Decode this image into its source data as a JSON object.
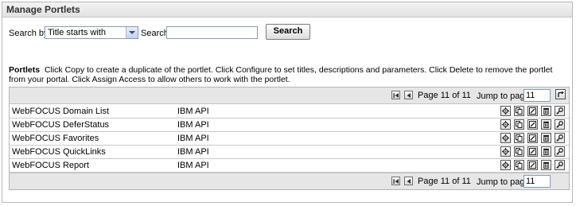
{
  "panel": {
    "title": "Manage Portlets"
  },
  "search": {
    "by_label": "Search by:",
    "by_value": "Title starts with",
    "label": "Search:",
    "value": "",
    "button_label": "Search"
  },
  "description": {
    "heading": "Portlets",
    "text": "Click Copy to create a duplicate of the portlet. Click Configure to set titles, descriptions and parameters. Click Delete to remove the portlet from your portal. Click Assign Access to allow others to work with the portlet."
  },
  "pager": {
    "info": "Page 11 of 11",
    "jump_label": "Jump to page:",
    "jump_value": "11"
  },
  "portlets": [
    {
      "name": "WebFOCUS Domain List",
      "type": "IBM API"
    },
    {
      "name": "WebFOCUS DeferStatus",
      "type": "IBM API"
    },
    {
      "name": "WebFOCUS Favorites",
      "type": "IBM API"
    },
    {
      "name": "WebFOCUS QuickLinks",
      "type": "IBM API"
    },
    {
      "name": "WebFOCUS Report",
      "type": "IBM API"
    }
  ],
  "row_actions": [
    "gear-icon",
    "copy-icon",
    "edit-icon",
    "delete-icon",
    "key-icon"
  ]
}
